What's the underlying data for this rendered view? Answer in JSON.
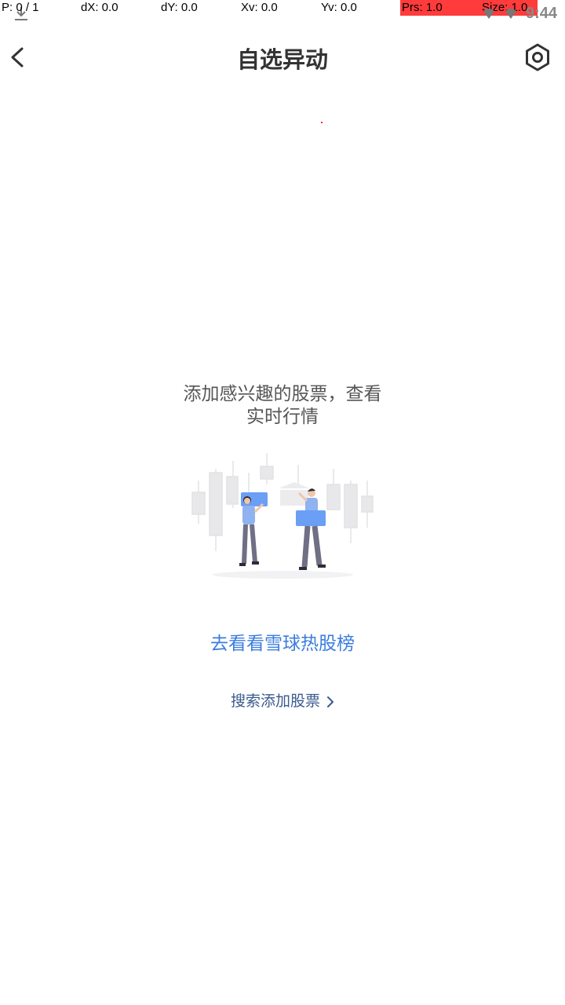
{
  "debug_overlay": {
    "p": "P: 0 / 1",
    "dx": "dX: 0.0",
    "dy": "dY: 0.0",
    "xv": "Xv: 0.0",
    "yv": "Yv: 0.0",
    "prs": "Prs: 1.0",
    "size": "Size: 1.0"
  },
  "status_bar": {
    "time": "9:44",
    "icons": [
      "download-icon",
      "signal-icon",
      "wifi-icon"
    ]
  },
  "header": {
    "title": "自选异动",
    "back_icon": "chevron-left-icon",
    "settings_icon": "hexagon-settings-icon"
  },
  "empty_state": {
    "message_line1": "添加感兴趣的股票，查看",
    "message_line2": "实时行情",
    "hot_list_link": "去看看雪球热股榜",
    "search_add_link": "搜索添加股票"
  },
  "colors": {
    "accent": "#3b7ddd",
    "secondary_link": "#3a5a8c",
    "title": "#333333",
    "debug_highlight": "#ff3b3b"
  }
}
